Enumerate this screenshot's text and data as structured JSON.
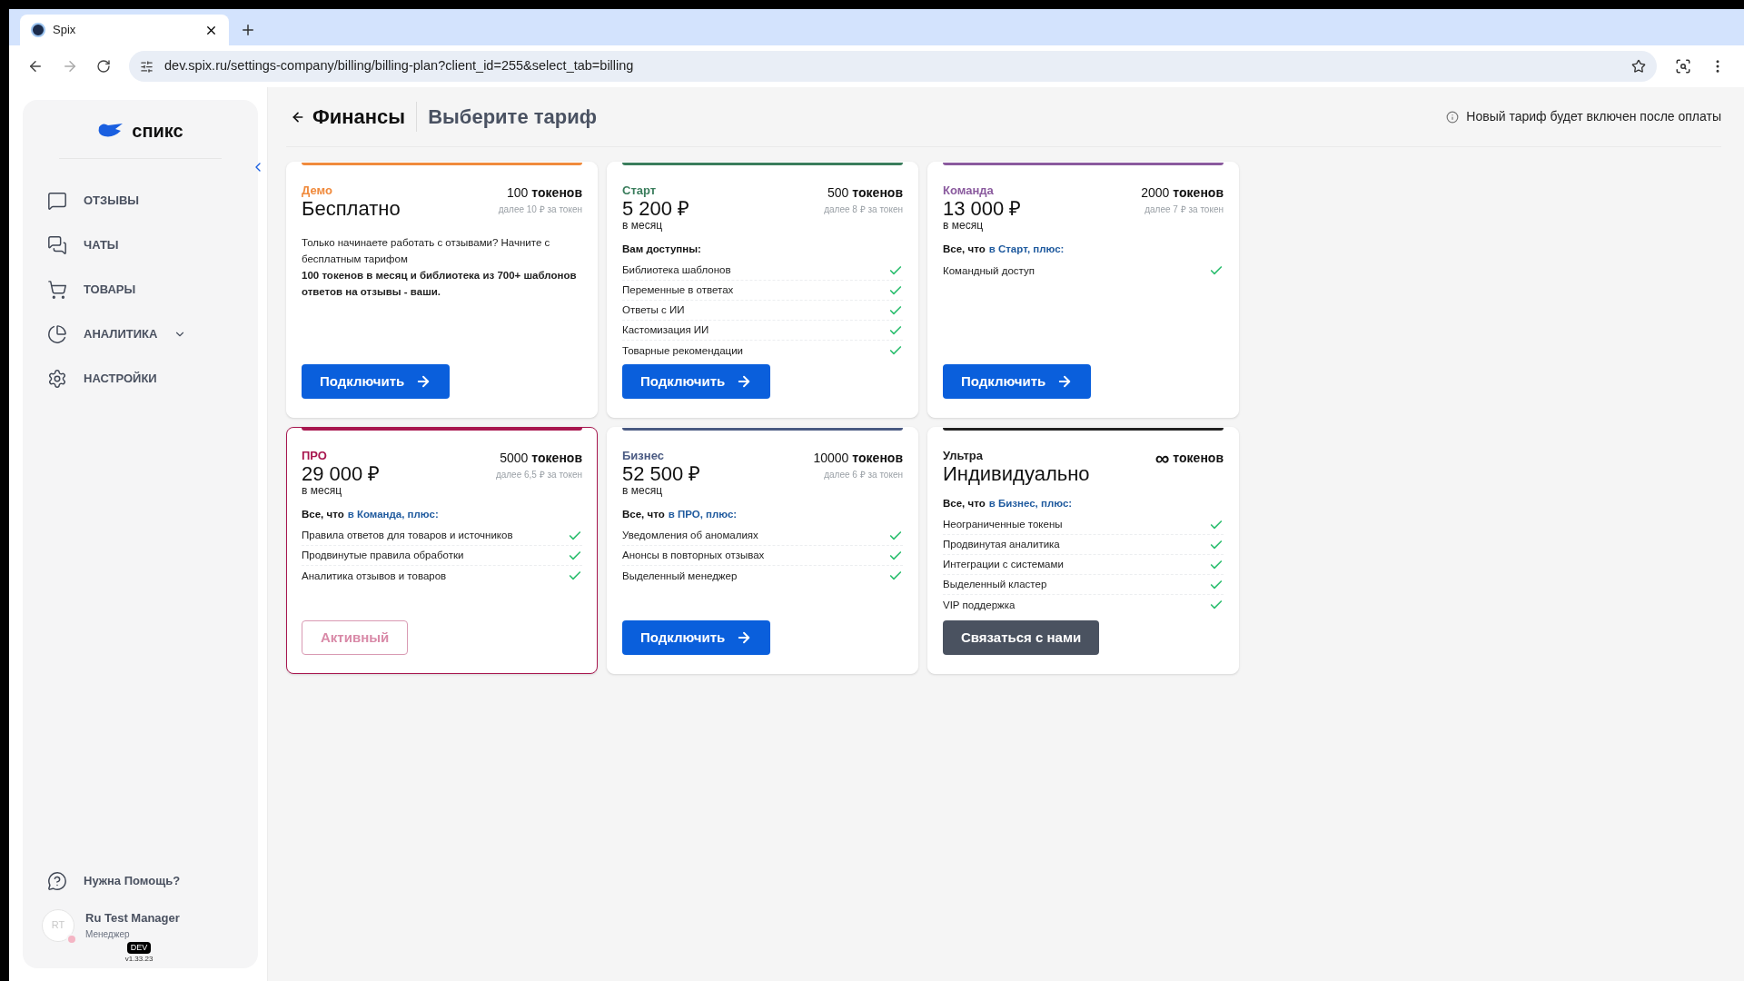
{
  "browser": {
    "tab_title": "Spix",
    "url": "dev.spix.ru/settings-company/billing/billing-plan?client_id=255&select_tab=billing"
  },
  "sidebar": {
    "logo_text": "спикс",
    "items": [
      {
        "label": "ОТЗЫВЫ",
        "has_submenu": false
      },
      {
        "label": "ЧАТЫ",
        "has_submenu": false
      },
      {
        "label": "ТОВАРЫ",
        "has_submenu": false
      },
      {
        "label": "АНАЛИТИКА",
        "has_submenu": true
      },
      {
        "label": "НАСТРОЙКИ",
        "has_submenu": false
      }
    ],
    "help": "Нужна Помощь?",
    "user": {
      "initials": "RT",
      "name": "Ru Test Manager",
      "role": "Менеджер",
      "alert": true
    },
    "env_badge": "DEV",
    "version": "v1.33.23"
  },
  "header": {
    "title": "Финансы",
    "subtitle": "Выберите тариф",
    "notice": "Новый тариф будет включен после оплаты"
  },
  "plans": [
    {
      "name": "Демо",
      "color": "#f08a3c",
      "price": "Бесплатно",
      "tokens": "100",
      "tokens_label": "токенов",
      "per_token": "далее 10 ₽ за токен",
      "selected": false,
      "kind": "description",
      "description": "Только начинаете работать с отзывами? Начните с бесплатным тарифом",
      "description_bold": "100 токенов в месяц и библиотека из 700+ шаблонов ответов на отзывы - ваши.",
      "button": {
        "kind": "connect",
        "label": "Подключить"
      }
    },
    {
      "name": "Старт",
      "color": "#3a7d5c",
      "price": "5 200 ₽",
      "period": "в месяц",
      "tokens": "500",
      "tokens_label": "токенов",
      "per_token": "далее 8 ₽ за токен",
      "selected": false,
      "kind": "features",
      "lead": "Вам доступны:",
      "features": [
        "Библиотека шаблонов",
        "Переменные в ответах",
        "Ответы с ИИ",
        "Кастомизация ИИ",
        "Товарные рекомендации"
      ],
      "button": {
        "kind": "connect",
        "label": "Подключить"
      }
    },
    {
      "name": "Команда",
      "color": "#8a5a9e",
      "price": "13 000 ₽",
      "period": "в месяц",
      "tokens": "2000",
      "tokens_label": "токенов",
      "per_token": "далее 7 ₽ за токен",
      "selected": false,
      "kind": "features",
      "lead": "Все, что",
      "lead_link": "в Старт, плюс:",
      "features": [
        "Командный доступ"
      ],
      "button": {
        "kind": "connect",
        "label": "Подключить"
      }
    },
    {
      "name": "ПРО",
      "color": "#a8174f",
      "price": "29 000 ₽",
      "period": "в месяц",
      "tokens": "5000",
      "tokens_label": "токенов",
      "per_token": "далее 6,5 ₽ за токен",
      "selected": true,
      "kind": "features",
      "lead": "Все, что",
      "lead_link": "в Команда, плюс:",
      "features": [
        "Правила ответов для товаров и источников",
        "Продвинутые правила обработки",
        "Аналитика отзывов и товаров"
      ],
      "button": {
        "kind": "active",
        "label": "Активный"
      }
    },
    {
      "name": "Бизнес",
      "color": "#4a5a82",
      "price": "52 500 ₽",
      "period": "в месяц",
      "tokens": "10000",
      "tokens_label": "токенов",
      "per_token": "далее 6 ₽ за токен",
      "selected": false,
      "kind": "features",
      "lead": "Все, что",
      "lead_link": "в ПРО, плюс:",
      "features": [
        "Уведомления об аномалиях",
        "Анонсы в повторных отзывах",
        "Выделенный менеджер"
      ],
      "button": {
        "kind": "connect",
        "label": "Подключить"
      }
    },
    {
      "name": "Ультра",
      "color": "#222222",
      "price": "Индивидуально",
      "tokens": "∞",
      "tokens_label": "токенов",
      "selected": false,
      "kind": "features",
      "lead": "Все, что",
      "lead_link": "в Бизнес, плюс:",
      "features": [
        "Неограниченные токены",
        "Продвинутая аналитика",
        "Интеграции с системами",
        "Выделенный кластер",
        "VIP поддержка"
      ],
      "button": {
        "kind": "contact",
        "label": "Связаться с нами"
      }
    }
  ]
}
